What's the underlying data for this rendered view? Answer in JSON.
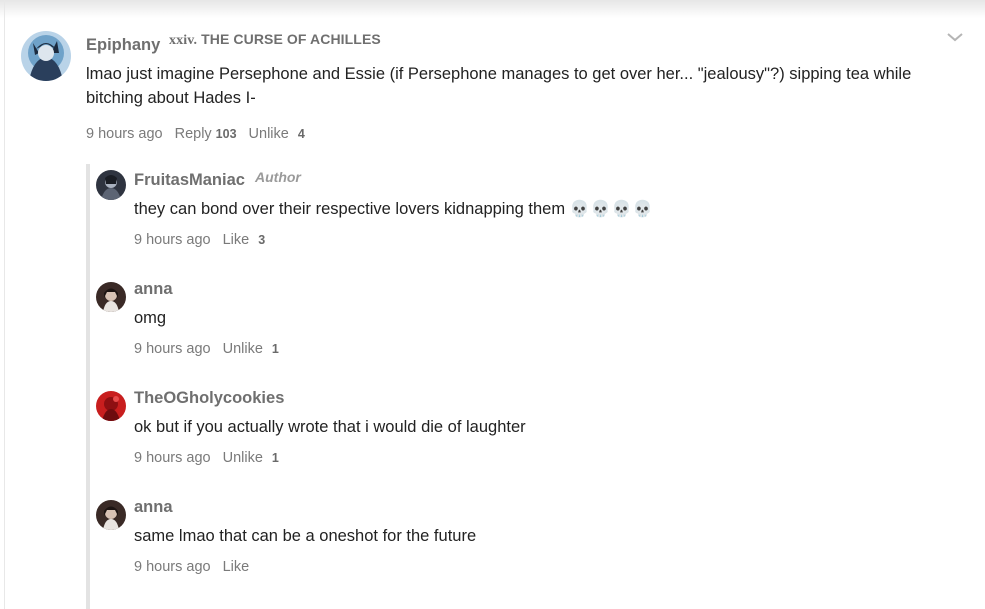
{
  "parent": {
    "username": "Epiphany",
    "chapter_prefix": "xxiv.",
    "chapter_title": "THE CURSE OF ACHILLES",
    "text_line1": "lmao just imagine Persephone and Essie (if Persephone manages to get over her... \"jealousy\"?) sipping tea while",
    "text_line2": "bitching about Hades I-",
    "time": "9 hours ago",
    "reply_label": "Reply",
    "reply_count": "103",
    "like_label": "Unlike",
    "like_count": "4"
  },
  "replies": [
    {
      "username": "FruitasManiac",
      "badge": "Author",
      "text": "they can bond over their respective lovers kidnapping them",
      "emoji": "💀💀💀💀",
      "time": "9 hours ago",
      "like_label": "Like",
      "like_count": "3"
    },
    {
      "username": "anna",
      "text": "omg",
      "time": "9 hours ago",
      "like_label": "Unlike",
      "like_count": "1"
    },
    {
      "username": "TheOGholycookies",
      "text": "ok but if you actually wrote that i would die of laughter",
      "time": "9 hours ago",
      "like_label": "Unlike",
      "like_count": "1"
    },
    {
      "username": "anna",
      "text": "same lmao that can be a oneshot for the future",
      "time": "9 hours ago",
      "like_label": "Like",
      "like_count": ""
    }
  ],
  "icons": {
    "options": "chevron-down-icon"
  },
  "colors": {
    "username": "#6f6f6f",
    "meta": "#7a7a7a",
    "thread_line": "#e3e3e3"
  }
}
